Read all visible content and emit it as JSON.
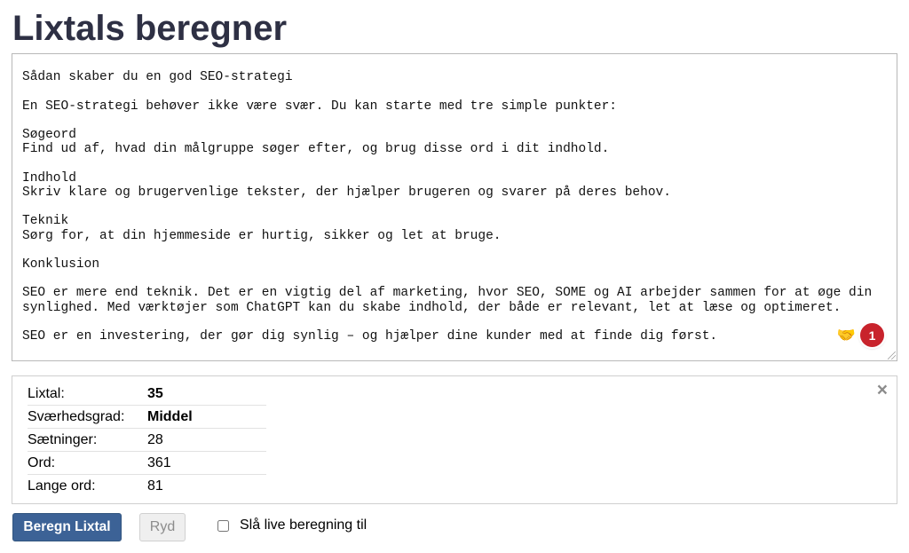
{
  "page": {
    "title": "Lixtals beregner"
  },
  "editor": {
    "text": "din viden med AI, står du stærkt i dit SEO-arbejde.\n\nSådan skaber du en god SEO-strategi\n\nEn SEO-strategi behøver ikke være svær. Du kan starte med tre simple punkter:\n\nSøgeord\nFind ud af, hvad din målgruppe søger efter, og brug disse ord i dit indhold.\n\nIndhold\nSkriv klare og brugervenlige tekster, der hjælper brugeren og svarer på deres behov.\n\nTeknik\nSørg for, at din hjemmeside er hurtig, sikker og let at bruge.\n\nKonklusion\n\nSEO er mere end teknik. Det er en vigtig del af marketing, hvor SEO, SOME og AI arbejder sammen for at øge din\nsynlighed. Med værktøjer som ChatGPT kan du skabe indhold, der både er relevant, let at læse og optimeret.\n\nSEO er en investering, der gør dig synlig – og hjælper dine kunder med at finde dig først.",
    "extension_icon": "handshake-icon",
    "badge_count": "1"
  },
  "results": {
    "close_label": "×",
    "rows": [
      {
        "label": "Lixtal:",
        "value": "35"
      },
      {
        "label": "Sværhedsgrad:",
        "value": "Middel"
      },
      {
        "label": "Sætninger:",
        "value": "28"
      },
      {
        "label": "Ord:",
        "value": "361"
      },
      {
        "label": "Lange ord:",
        "value": "81"
      }
    ]
  },
  "controls": {
    "calculate_label": "Beregn Lixtal",
    "clear_label": "Ryd",
    "live_label": "Slå live beregning til",
    "live_checked": false
  },
  "colors": {
    "title": "#2e3044",
    "primary_button": "#3c6296",
    "badge": "#c8232c"
  }
}
